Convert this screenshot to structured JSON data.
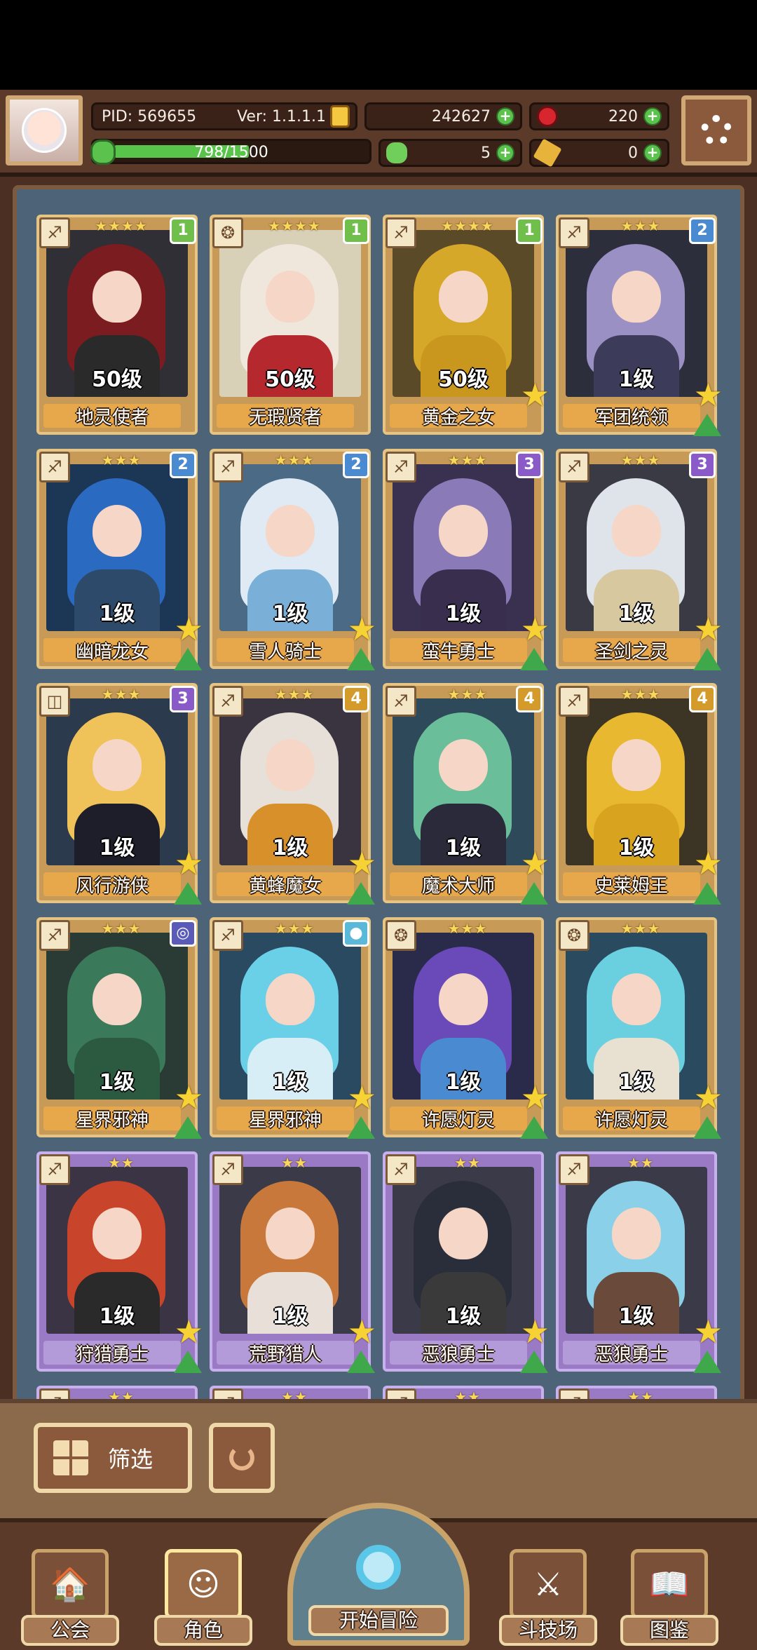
{
  "header": {
    "pid": "PID: 569655",
    "version": "Ver: 1.1.1.1",
    "gold": "242627",
    "gems": "220",
    "xp": "798/1500",
    "xp_fraction": 0.532,
    "clover": "5",
    "keys": "0"
  },
  "cards": [
    {
      "name": "地灵使者",
      "level": "50级",
      "stars": "★★★★",
      "rank": "1",
      "rank_color": "#6fbf4a",
      "hair": "#7a1c20",
      "bg": "#2f2f35",
      "body": "#2a2a2a",
      "frame": "gold",
      "type_icon": "♐",
      "star_badge": false,
      "up_badge": false
    },
    {
      "name": "无瑕贤者",
      "level": "50级",
      "stars": "★★★★",
      "rank": "1",
      "rank_color": "#6fbf4a",
      "hair": "#efe7dc",
      "bg": "#d9d0b8",
      "body": "#b5282e",
      "frame": "gold",
      "type_icon": "❂",
      "star_badge": false,
      "up_badge": false
    },
    {
      "name": "黄金之女",
      "level": "50级",
      "stars": "★★★★",
      "rank": "1",
      "rank_color": "#6fbf4a",
      "hair": "#d6a82a",
      "bg": "#5a4a28",
      "body": "#c9961e",
      "frame": "gold",
      "type_icon": "♐",
      "star_badge": true,
      "up_badge": false
    },
    {
      "name": "军团统领",
      "level": "1级",
      "stars": "★★★",
      "rank": "2",
      "rank_color": "#4a8ad0",
      "hair": "#9a90c4",
      "bg": "#2d2e3c",
      "body": "#3d3b5a",
      "frame": "gold",
      "type_icon": "♐",
      "star_badge": true,
      "up_badge": true
    },
    {
      "name": "幽暗龙女",
      "level": "1级",
      "stars": "★★★",
      "rank": "2",
      "rank_color": "#4a8ad0",
      "hair": "#2a6ac0",
      "bg": "#1c3656",
      "body": "#2d4a6a",
      "frame": "gold",
      "type_icon": "♐",
      "star_badge": true,
      "up_badge": true
    },
    {
      "name": "雪人骑士",
      "level": "1级",
      "stars": "★★★",
      "rank": "2",
      "rank_color": "#4a8ad0",
      "hair": "#dfeaf5",
      "bg": "#4b6a86",
      "body": "#7ab0d8",
      "frame": "gold",
      "type_icon": "♐",
      "star_badge": true,
      "up_badge": true
    },
    {
      "name": "蛮牛勇士",
      "level": "1级",
      "stars": "★★★",
      "rank": "3",
      "rank_color": "#8a5ac8",
      "hair": "#8a7ab8",
      "bg": "#3a3050",
      "body": "#3a2e4e",
      "frame": "gold",
      "type_icon": "♐",
      "star_badge": true,
      "up_badge": true
    },
    {
      "name": "圣剑之灵",
      "level": "1级",
      "stars": "★★★",
      "rank": "3",
      "rank_color": "#8a5ac8",
      "hair": "#dfe4ea",
      "bg": "#3a3a44",
      "body": "#d8c8a0",
      "frame": "gold",
      "type_icon": "♐",
      "star_badge": true,
      "up_badge": true
    },
    {
      "name": "风行游侠",
      "level": "1级",
      "stars": "★★★",
      "rank": "3",
      "rank_color": "#8a5ac8",
      "hair": "#f0c25a",
      "bg": "#2b3a4c",
      "body": "#1e1e2a",
      "frame": "gold",
      "type_icon": "◫",
      "star_badge": true,
      "up_badge": true
    },
    {
      "name": "黄蜂魔女",
      "level": "1级",
      "stars": "★★★",
      "rank": "4",
      "rank_color": "#d49a2a",
      "hair": "#e6e0d8",
      "bg": "#3a3440",
      "body": "#d8902a",
      "frame": "gold",
      "type_icon": "♐",
      "star_badge": true,
      "up_badge": true
    },
    {
      "name": "魔术大师",
      "level": "1级",
      "stars": "★★★",
      "rank": "4",
      "rank_color": "#d49a2a",
      "hair": "#6abf9a",
      "bg": "#2e4a5a",
      "body": "#2a2a3a",
      "frame": "gold",
      "type_icon": "♐",
      "star_badge": true,
      "up_badge": true
    },
    {
      "name": "史莱姆王",
      "level": "1级",
      "stars": "★★★",
      "rank": "4",
      "rank_color": "#d49a2a",
      "hair": "#e8b830",
      "bg": "#3c3424",
      "body": "#d8a420",
      "frame": "gold",
      "type_icon": "♐",
      "star_badge": true,
      "up_badge": true
    },
    {
      "name": "星界邪神",
      "level": "1级",
      "stars": "★★★",
      "rank": "◎",
      "rank_color": "#5a5ab8",
      "hair": "#3a7a5a",
      "bg": "#2a3a34",
      "body": "#2c5a40",
      "frame": "gold",
      "type_icon": "♐",
      "star_badge": true,
      "up_badge": true
    },
    {
      "name": "星界邪神",
      "level": "1级",
      "stars": "★★★",
      "rank": "●",
      "rank_color": "#5ab8d8",
      "hair": "#6ad0e8",
      "bg": "#2a4a62",
      "body": "#d8eef6",
      "frame": "gold",
      "type_icon": "♐",
      "star_badge": true,
      "up_badge": true
    },
    {
      "name": "许愿灯灵",
      "level": "1级",
      "stars": "★★★",
      "rank": "",
      "rank_color": "",
      "hair": "#6a4ab8",
      "bg": "#2a2a4a",
      "body": "#4a8ad0",
      "frame": "gold",
      "type_icon": "❂",
      "star_badge": true,
      "up_badge": true
    },
    {
      "name": "许愿灯灵",
      "level": "1级",
      "stars": "★★★",
      "rank": "",
      "rank_color": "",
      "hair": "#6ad0e0",
      "bg": "#2a4a60",
      "body": "#e8e0d0",
      "frame": "gold",
      "type_icon": "❂",
      "star_badge": true,
      "up_badge": true
    },
    {
      "name": "狩猎勇士",
      "level": "1级",
      "stars": "★★",
      "rank": "",
      "rank_color": "",
      "hair": "#c8442a",
      "bg": "#3a3444",
      "body": "#2a2a2a",
      "frame": "purple",
      "type_icon": "♐",
      "star_badge": true,
      "up_badge": true
    },
    {
      "name": "荒野猎人",
      "level": "1级",
      "stars": "★★",
      "rank": "",
      "rank_color": "",
      "hair": "#c8783a",
      "bg": "#3a3a48",
      "body": "#e8e0d8",
      "frame": "purple",
      "type_icon": "♐",
      "star_badge": true,
      "up_badge": true
    },
    {
      "name": "恶狼勇士",
      "level": "1级",
      "stars": "★★",
      "rank": "",
      "rank_color": "",
      "hair": "#2a2e3a",
      "bg": "#3a3a48",
      "body": "#3a3a3a",
      "frame": "purple",
      "type_icon": "♐",
      "star_badge": true,
      "up_badge": true
    },
    {
      "name": "恶狼勇士",
      "level": "1级",
      "stars": "★★",
      "rank": "",
      "rank_color": "",
      "hair": "#8ad0e8",
      "bg": "#3a3a48",
      "body": "#6a4a3a",
      "frame": "purple",
      "type_icon": "♐",
      "star_badge": true,
      "up_badge": true
    },
    {
      "name": "",
      "level": "",
      "stars": "★★",
      "rank": "",
      "rank_color": "",
      "hair": "#8ad0e8",
      "bg": "#3a3a48",
      "body": "#3a3a3a",
      "frame": "purple",
      "type_icon": "♐",
      "star_badge": false,
      "up_badge": false
    },
    {
      "name": "",
      "level": "",
      "stars": "★★",
      "rank": "",
      "rank_color": "",
      "hair": "#c8783a",
      "bg": "#3a3a48",
      "body": "#3a3a3a",
      "frame": "purple",
      "type_icon": "♐",
      "star_badge": false,
      "up_badge": false
    },
    {
      "name": "",
      "level": "",
      "stars": "★★",
      "rank": "",
      "rank_color": "",
      "hair": "#3a7a5a",
      "bg": "#3a3a48",
      "body": "#3a3a3a",
      "frame": "purple",
      "type_icon": "♐",
      "star_badge": false,
      "up_badge": false
    },
    {
      "name": "",
      "level": "",
      "stars": "★★",
      "rank": "",
      "rank_color": "",
      "hair": "#dfeaf5",
      "bg": "#3a3a48",
      "body": "#3a3a3a",
      "frame": "purple",
      "type_icon": "♐",
      "star_badge": false,
      "up_badge": false
    }
  ],
  "filter": {
    "label": "筛选"
  },
  "nav": {
    "guild": "公会",
    "character": "角色",
    "adventure": "开始冒险",
    "arena": "斗技场",
    "codex": "图鉴"
  }
}
